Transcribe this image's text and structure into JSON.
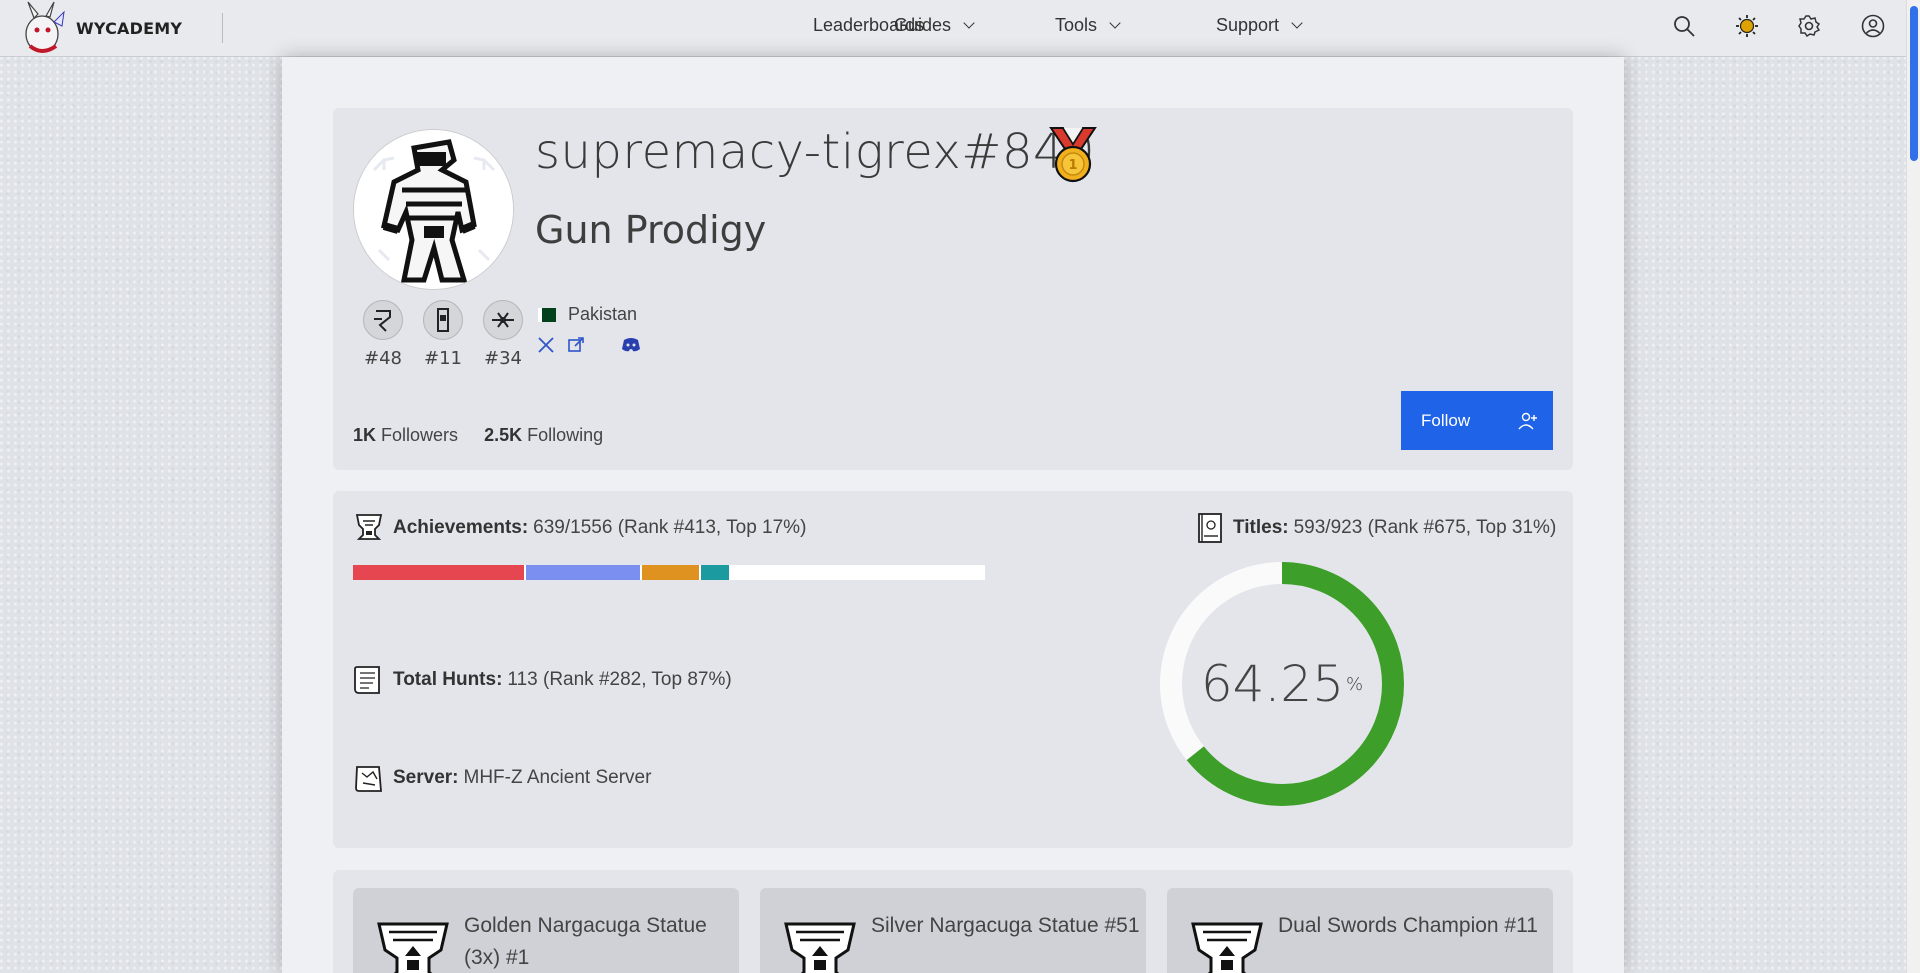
{
  "nav": {
    "brand": "WYCADEMY",
    "links": [
      {
        "label": "Leaderboards"
      },
      {
        "label": "Guides"
      },
      {
        "label": "Tools"
      },
      {
        "label": "Support"
      }
    ]
  },
  "profile": {
    "username": "supremacy-tigrex#840",
    "title": "Gun Prodigy",
    "country": "Pakistan",
    "badges": [
      "#48",
      "#11",
      "#34"
    ],
    "followers_count": "1K",
    "followers_label": "Followers",
    "following_count": "2.5K",
    "following_label": "Following",
    "follow_button": "Follow"
  },
  "stats": {
    "achievements_label": "Achievements:",
    "achievements_value": "639/1556 (Rank #413, Top 17%)",
    "achievements_bar": [
      {
        "fraction": 0.27,
        "color": "#e5464f"
      },
      {
        "fraction": 0.18,
        "color": "#7a8fef"
      },
      {
        "fraction": 0.09,
        "color": "#e09221"
      },
      {
        "fraction": 0.045,
        "color": "#1b9aa0"
      }
    ],
    "titles_label": "Titles:",
    "titles_value": "593/923 (Rank #675, Top 31%)",
    "titles_percent": 64.25,
    "titles_percent_text": "64.25",
    "titles_percent_unit": "%",
    "hunts_label": "Total Hunts:",
    "hunts_value": "113 (Rank #282, Top 87%)",
    "server_label": "Server:",
    "server_value": "MHF-Z Ancient Server",
    "donut_color": "#3d9e2a"
  },
  "awards": [
    {
      "name": "Golden Nargacuga Statue (3x) #1"
    },
    {
      "name": "Silver Nargacuga Statue #51"
    },
    {
      "name": "Dual Swords Champion #11"
    }
  ]
}
